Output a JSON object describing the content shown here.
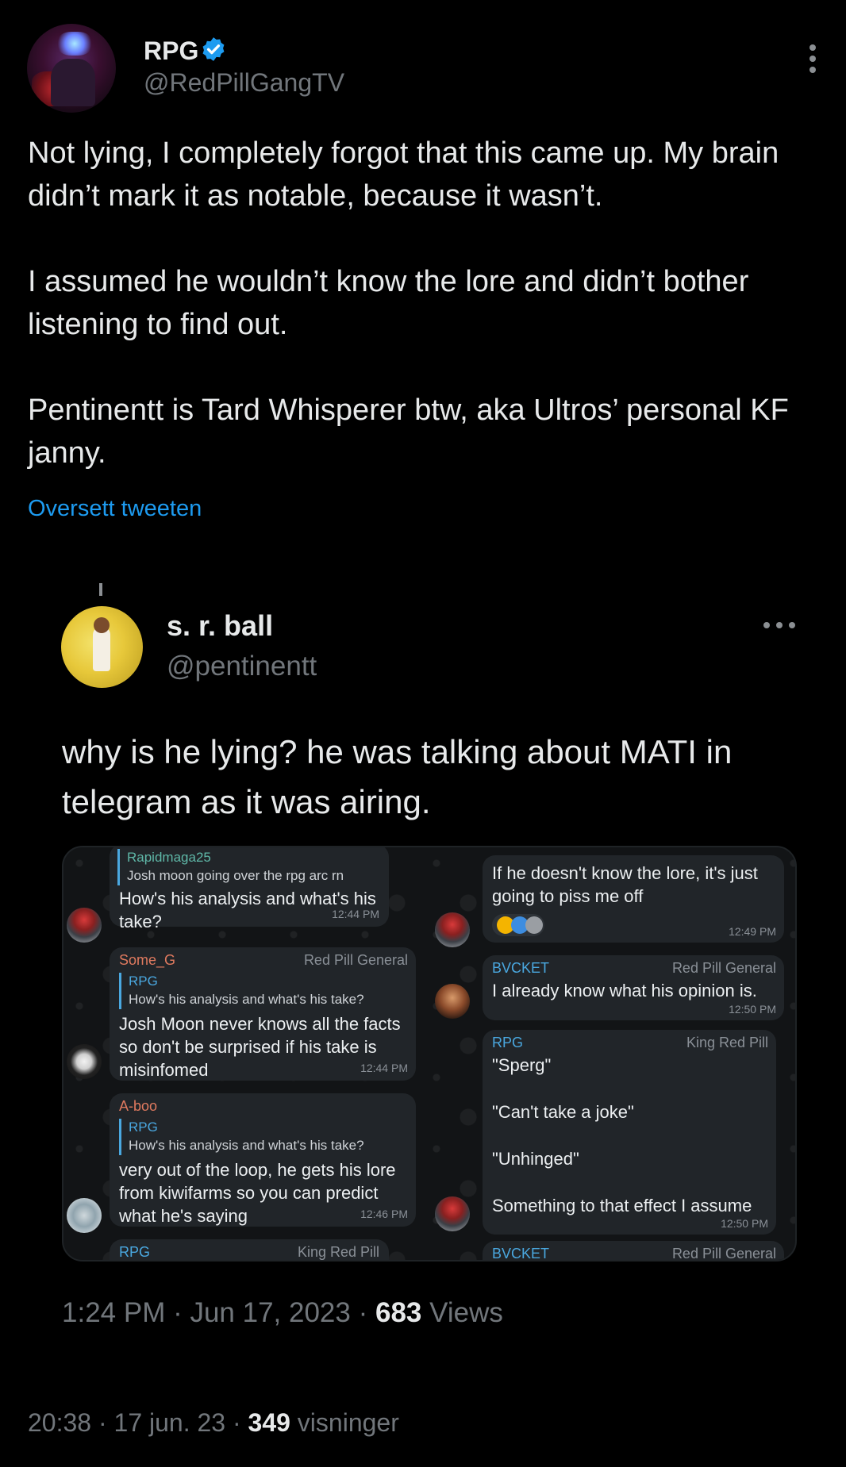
{
  "tweet": {
    "author_name": "RPG",
    "author_handle": "@RedPillGangTV",
    "paragraphs": [
      "Not lying, I completely forgot that this came up. My brain didn’t mark it as notable, because it wasn’t.",
      "I assumed he wouldn’t know the lore and didn’t bother listening to find out.",
      "Pentinentt is Tard Whisperer btw, aka Ultros’ personal KF janny."
    ],
    "translate_label": "Oversett tweeten",
    "meta_time": "20:38",
    "meta_date": "17 jun. 23",
    "meta_views_count": "349",
    "meta_views_label": "visninger"
  },
  "quoted": {
    "author_name": "s. r. ball",
    "author_handle": "@pentinentt",
    "text": "why is he lying? he was talking about MATI in telegram as it was airing.",
    "meta_time": "1:24 PM",
    "meta_date": "Jun 17, 2023",
    "meta_views_count": "683",
    "meta_views_label": "Views"
  },
  "telegram": {
    "left": [
      {
        "reply_name": "Rapidmaga25",
        "reply_text": "Josh moon going over the rpg arc rn",
        "text_lines": [
          "How's his analysis and what's his",
          "take?"
        ],
        "time": "12:44 PM"
      },
      {
        "sender": "Some_G",
        "tag": "Red Pill General",
        "reply_name": "RPG",
        "reply_text": "How's his analysis and what's his take?",
        "text_lines": [
          "Josh Moon never knows all the facts",
          "so don't be surprised if his take is",
          "misinfomed"
        ],
        "time": "12:44 PM"
      },
      {
        "sender": "A-boo",
        "reply_name": "RPG",
        "reply_text": "How's his analysis and what's his take?",
        "text_lines": [
          "very out of the loop, he gets his lore",
          "from kiwifarms so you can predict",
          "what he's saying"
        ],
        "time": "12:46 PM"
      },
      {
        "sender": "RPG",
        "tag": "King Red Pill"
      }
    ],
    "right": [
      {
        "text_lines": [
          "If he doesn't know the lore, it's just",
          "going to piss me off"
        ],
        "time": "12:49 PM"
      },
      {
        "sender": "BVCKET",
        "tag": "Red Pill General",
        "text_lines": [
          "I already know what his opinion is."
        ],
        "time": "12:50 PM"
      },
      {
        "sender": "RPG",
        "tag": "King Red Pill",
        "text_lines": [
          "\"Sperg\"",
          "\"Can't take a joke\"",
          "\"Unhinged\"",
          "Something to that effect I assume"
        ],
        "time": "12:50 PM"
      },
      {
        "sender": "BVCKET",
        "tag": "Red Pill General"
      }
    ],
    "colors": {
      "rapidmaga": "#5fb8a8",
      "some_g": "#e07a5f",
      "aboo": "#e07a5f",
      "rpg": "#4aa8e0",
      "bvcket": "#4aa8e0"
    }
  },
  "colors": {
    "background": "#000000",
    "text": "#e7e9ea",
    "muted": "#71767b",
    "link": "#1d9bf0",
    "verified": "#1d9bf0"
  },
  "icons": [
    "verified-badge-icon",
    "more-vertical-icon",
    "more-horizontal-icon"
  ]
}
